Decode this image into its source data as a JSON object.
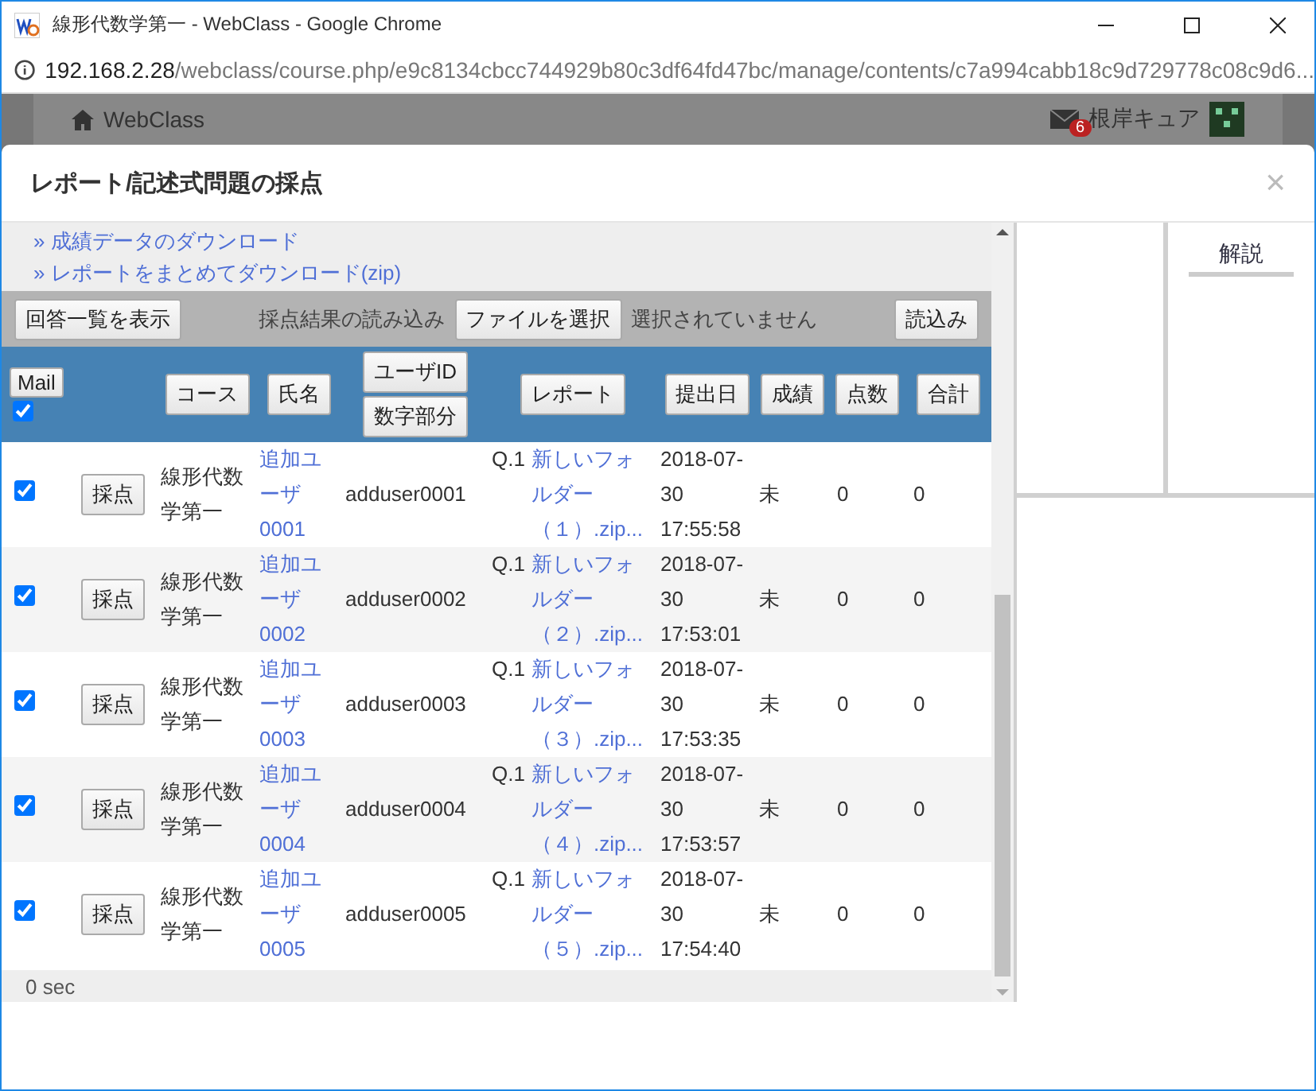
{
  "window": {
    "title": "線形代数学第一 - WebClass - Google Chrome",
    "url_host": "192.168.2.28",
    "url_path": "/webclass/course.php/e9c8134cbcc744929b80c3df64fd47bc/manage/contents/c7a994cabb18c9d729778c08c9d6..."
  },
  "background_page": {
    "brand": "WebClass",
    "notification_count": "6",
    "user": "根岸キュア"
  },
  "dialog": {
    "title": "レポート/記述式問題の採点",
    "close": "×",
    "links": [
      "» 成績データのダウンロード",
      "» レポートをまとめてダウンロード(zip)"
    ],
    "toolbar": {
      "show_answers": "回答一覧を表示",
      "import_label": "採点結果の読み込み",
      "file_button": "ファイルを選択",
      "file_status": "選択されていません",
      "load_button": "読込み"
    },
    "header": {
      "mail_button": "Mail",
      "mail_checked": true,
      "columns": [
        {
          "label": "コース"
        },
        {
          "label": "氏名"
        },
        {
          "label": "ユーザID",
          "sub": "数字部分"
        },
        {
          "label": "レポート"
        },
        {
          "label": "提出日"
        },
        {
          "label": "成績"
        },
        {
          "label": "点数"
        },
        {
          "label": "合計"
        }
      ]
    },
    "rows": [
      {
        "checked": true,
        "grade_button": "採点",
        "course": "線形代数学第一",
        "name": "追加ユーザ0001",
        "user_id": "adduser0001",
        "question": "Q.1",
        "file": "新しいフォルダー（１）.zip...",
        "submitted": "2018-07-30 17:55:58",
        "grade": "未",
        "score": "0",
        "total": "0"
      },
      {
        "checked": true,
        "grade_button": "採点",
        "course": "線形代数学第一",
        "name": "追加ユーザ0002",
        "user_id": "adduser0002",
        "question": "Q.1",
        "file": "新しいフォルダー（２）.zip...",
        "submitted": "2018-07-30 17:53:01",
        "grade": "未",
        "score": "0",
        "total": "0"
      },
      {
        "checked": true,
        "grade_button": "採点",
        "course": "線形代数学第一",
        "name": "追加ユーザ0003",
        "user_id": "adduser0003",
        "question": "Q.1",
        "file": "新しいフォルダー（３）.zip...",
        "submitted": "2018-07-30 17:53:35",
        "grade": "未",
        "score": "0",
        "total": "0"
      },
      {
        "checked": true,
        "grade_button": "採点",
        "course": "線形代数学第一",
        "name": "追加ユーザ0004",
        "user_id": "adduser0004",
        "question": "Q.1",
        "file": "新しいフォルダー（４）.zip...",
        "submitted": "2018-07-30 17:53:57",
        "grade": "未",
        "score": "0",
        "total": "0"
      },
      {
        "checked": true,
        "grade_button": "採点",
        "course": "線形代数学第一",
        "name": "追加ユーザ0005",
        "user_id": "adduser0005",
        "question": "Q.1",
        "file": "新しいフォルダー（５）.zip...",
        "submitted": "2018-07-30 17:54:40",
        "grade": "未",
        "score": "0",
        "total": "0"
      }
    ],
    "footer": "0 sec",
    "side_tab": "解説"
  }
}
